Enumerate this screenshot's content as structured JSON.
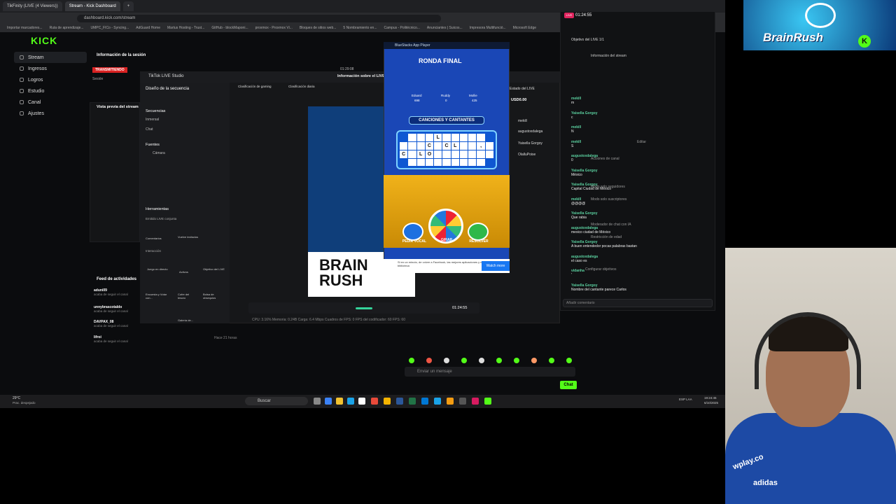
{
  "browser": {
    "tabs": [
      "TikFinity (LIVE (4 Viewers))",
      "Stream - Kick Dashboard"
    ],
    "url": "dashboard.kick.com/stream",
    "bookmarks": [
      "Importar marcadores...",
      "Ruta de aprendizaje...",
      "UMPC_FICo - Syncing...",
      "AdGuard Home",
      "Martus Hosting - Trust...",
      "GitHub - blockMaponi...",
      "proxmox - Proxmox Vi...",
      "Bloques de sitios web...",
      "5 Nombramiento en...",
      "Campus - Politécnico...",
      "Anunciantes | Suicos...",
      "Impresora Multifunció...",
      "Microsoft Edge"
    ]
  },
  "kick": {
    "logo": "KICK",
    "sidebar": [
      "Stream",
      "Ingresos",
      "Logros",
      "Estudio",
      "Canal",
      "Ajustes"
    ],
    "info_title": "Información de la sesión",
    "live_badge": "TRANSMITIENDO",
    "session_label": "Sesión",
    "preview_title": "Vista previa del stream",
    "feed_title": "Feed de actividades",
    "feed": [
      {
        "user": "aduni09",
        "text": "acaba de seguir el canal"
      },
      {
        "user": "unnybrascotaldo",
        "text": "acaba de seguir el canal"
      },
      {
        "user": "DAVPAX_08",
        "text": "acaba de seguir el canal"
      },
      {
        "user": "lifroi",
        "text": "acaba de seguir el canal"
      }
    ],
    "feed_time": "Hace 21 horas",
    "message_placeholder": "Enviar un mensaje",
    "chat_button": "Chat"
  },
  "tiktok": {
    "title": "TikTok LIVE Studio",
    "live_info": "Información sobre el LIVE",
    "timer": "01:29:08",
    "design": "Diseño de la secuencia",
    "sequences": "Secuencias",
    "seq_items": [
      "Inmersal",
      "Chat"
    ],
    "sources": "Fuentes",
    "source_items": [
      "Cámara"
    ],
    "tools": "Herramientas",
    "tools_sub": "Emitido LIVE conjunta",
    "tool_items": [
      "Comentarios",
      "Vuelve invitados",
      "Juego en directo",
      "Activos",
      "Objetivo del LIVE",
      "Encuesta y Votar con...",
      "Cofre del tesoro",
      "Bolsa de obsequios",
      "Galería de..."
    ],
    "interaction": "Interacción",
    "rank1": "Clasificación de gaming",
    "rank2": "Clasificación diaria",
    "ctrl_time": "01:24:55",
    "stats": "CPU: 3.16%   Memoria: 0.24B   Carga: 6.4 Mbps   Cuadros de FPS: 0   FPS del codificador: 60   FPS: 60",
    "wallet": "USD0.00",
    "viewers": [
      "mekill",
      "augustoxdalega",
      "Yaisella Gorgoy",
      "OlalluPoise"
    ],
    "live_state": "Estado del LIVE"
  },
  "game": {
    "window": "BlueStacks App Player",
    "round": "RONDA FINAL",
    "category": "CANCIONES Y CANTANTES",
    "players": [
      {
        "name": "Eduard",
        "score": "698"
      },
      {
        "name": "Ruddy",
        "score": "0"
      },
      {
        "name": "Mollie",
        "score": "425"
      }
    ],
    "board_rows": [
      [
        "",
        "",
        "",
        "",
        "L",
        "",
        "",
        "",
        "",
        "",
        ""
      ],
      [
        "",
        "",
        "",
        "C",
        "",
        "C",
        "L",
        "",
        "",
        ",",
        ""
      ],
      [
        "C",
        "",
        "L",
        "O",
        "",
        "",
        "",
        "",
        "",
        "",
        ""
      ],
      [
        "",
        "",
        "",
        "",
        "",
        "",
        "",
        "",
        "",
        "",
        ""
      ]
    ],
    "btn_left": "PEDIR VOCAL",
    "btn_mid": "GIRAR",
    "btn_right": "RESOLVER",
    "promo_text": "Si en un minuto, de volver a Facebook, las mejores aplicaciones y más, en la biblioteca",
    "promo_btn": "Watch more",
    "logo_text": "BRAIN RUSH"
  },
  "chat": {
    "live_time": "01:24:55",
    "goal": "Objetivo del LIVE 1/1",
    "stream_info": "Información del stream",
    "messages": [
      {
        "user": "mekill",
        "text": "m"
      },
      {
        "user": "Yaisella Gorgoy",
        "text": "c"
      },
      {
        "user": "mekill",
        "text": "N"
      },
      {
        "user": "mekill",
        "text": "S"
      },
      {
        "user": "augustoxdalega",
        "text": "0"
      },
      {
        "user": "Yaisella Gorgoy",
        "text": "Mèxico"
      },
      {
        "user": "Yaisella Gorgoy",
        "text": "Capital Ciudad de México"
      },
      {
        "user": "mekill",
        "text": "@@@@"
      },
      {
        "user": "Yaisella Gorgoy",
        "text": "Que rabia"
      },
      {
        "user": "augustoxdalega",
        "text": "mexico ciudad de México"
      },
      {
        "user": "Yaisella Gorgoy",
        "text": "A buen entendedor pocas palabras bastan"
      },
      {
        "user": "augustoxdalega",
        "text": "el caso es"
      },
      {
        "user": "vidanha",
        "text": "'"
      },
      {
        "user": "Yaisella Gorgoy",
        "text": "Nombre del cantante parece Carlos"
      }
    ],
    "menu_items": [
      "Editar",
      "Acciones de canal",
      "Modo solo seguidores",
      "Modo solo suscriptores",
      "Moderador de chat con IA",
      "Restricción de edad",
      "Configurar objetivos"
    ],
    "input_placeholder": "Añadir comentario"
  },
  "taskbar": {
    "search": "Buscar",
    "weather": "29°C",
    "weather_desc": "Prac. despejado",
    "lang": "ESP LAA",
    "time": "19:24:45",
    "date": "6/10/2025"
  },
  "banner": {
    "title": "BrainRush",
    "badge": "K"
  },
  "webcam": {
    "shirt_brand": "wplay.co",
    "shirt_brand2": "adidas"
  },
  "colors": {
    "kick_green": "#53fc18",
    "live_red": "#d92222",
    "game_blue": "#1a47b6"
  }
}
